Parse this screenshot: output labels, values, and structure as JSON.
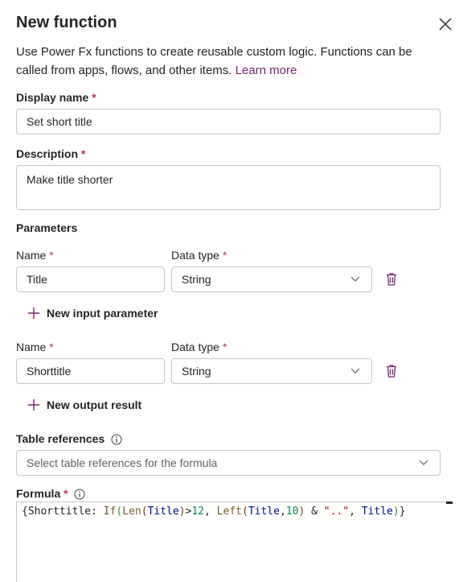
{
  "dialog": {
    "title": "New function",
    "description": "Use Power Fx functions to create reusable custom logic. Functions can be called from apps, flows, and other items.",
    "learn_more": "Learn more",
    "close_icon": "close-icon"
  },
  "display_name": {
    "label": "Display name",
    "required": "*",
    "value": "Set short title"
  },
  "description_field": {
    "label": "Description",
    "required": "*",
    "value": "Make title shorter"
  },
  "parameters": {
    "heading": "Parameters",
    "name_label": "Name",
    "type_label": "Data type",
    "required": "*",
    "input": {
      "name": "Title",
      "type": "String"
    },
    "add_input_label": "New input parameter",
    "output": {
      "name": "Shorttitle",
      "type": "String"
    },
    "add_output_label": "New output result"
  },
  "table_references": {
    "label": "Table references",
    "placeholder": "Select table references for the formula"
  },
  "formula": {
    "label": "Formula",
    "required": "*",
    "tokens": [
      "{",
      "Shorttitle",
      ": ",
      "If",
      "(",
      "Len",
      "(",
      "Title",
      ")",
      ">",
      "12",
      ", ",
      "Left",
      "(",
      "Title",
      ",",
      "10",
      ")",
      " & ",
      "\"..\"",
      ", ",
      "Title",
      ")",
      "}"
    ]
  },
  "colors": {
    "accent": "#742774",
    "required": "#c4314b",
    "border": "#c8c6c4"
  }
}
